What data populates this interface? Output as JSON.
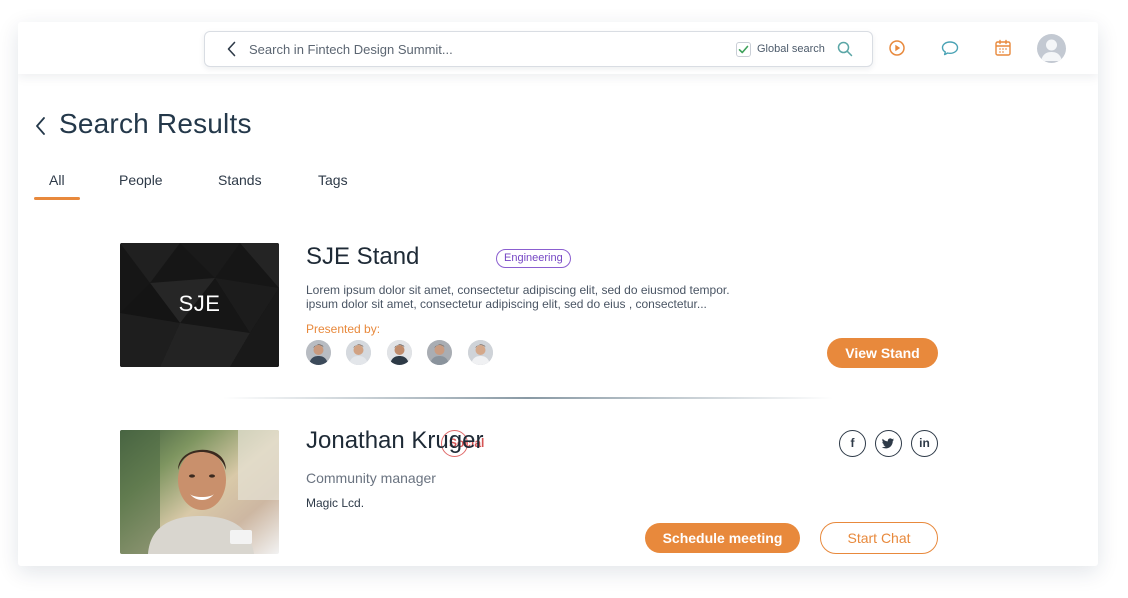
{
  "search": {
    "placeholder": "Search in Fintech Design Summit...",
    "global_label": "Global search"
  },
  "icons": {
    "back": "chevron-left-icon",
    "check": "check-icon",
    "search": "search-icon",
    "play": "play-circle-icon",
    "chat": "chat-bubble-icon",
    "calendar": "calendar-icon",
    "avatar": "user-avatar-icon"
  },
  "page": {
    "title": "Search Results"
  },
  "tabs": [
    {
      "label": "All",
      "active": true
    },
    {
      "label": "People",
      "active": false
    },
    {
      "label": "Stands",
      "active": false
    },
    {
      "label": "Tags",
      "active": false
    }
  ],
  "stand": {
    "image_text": "SJE",
    "name": "SJE Stand",
    "tags": [
      "Social",
      "Engineering"
    ],
    "description_1": "Lorem ipsum dolor sit amet, consectetur adipiscing elit, sed do eiusmod tempor.",
    "description_2": "ipsum dolor sit amet, consectetur adipiscing elit, sed do eius , consectetur...",
    "presented_by": "Presented by:",
    "view_button": "View Stand"
  },
  "person": {
    "name": "Jonathan Kruger",
    "role": "Community manager",
    "company": "Magic Lcd.",
    "social": [
      "f",
      "t",
      "in"
    ],
    "schedule_button": "Schedule meeting",
    "chat_button": "Start Chat"
  },
  "colors": {
    "accent": "#e8893c",
    "text_dark": "#1e2a36",
    "social_tag": "#d55454",
    "engineering_tag": "#7546c4"
  }
}
